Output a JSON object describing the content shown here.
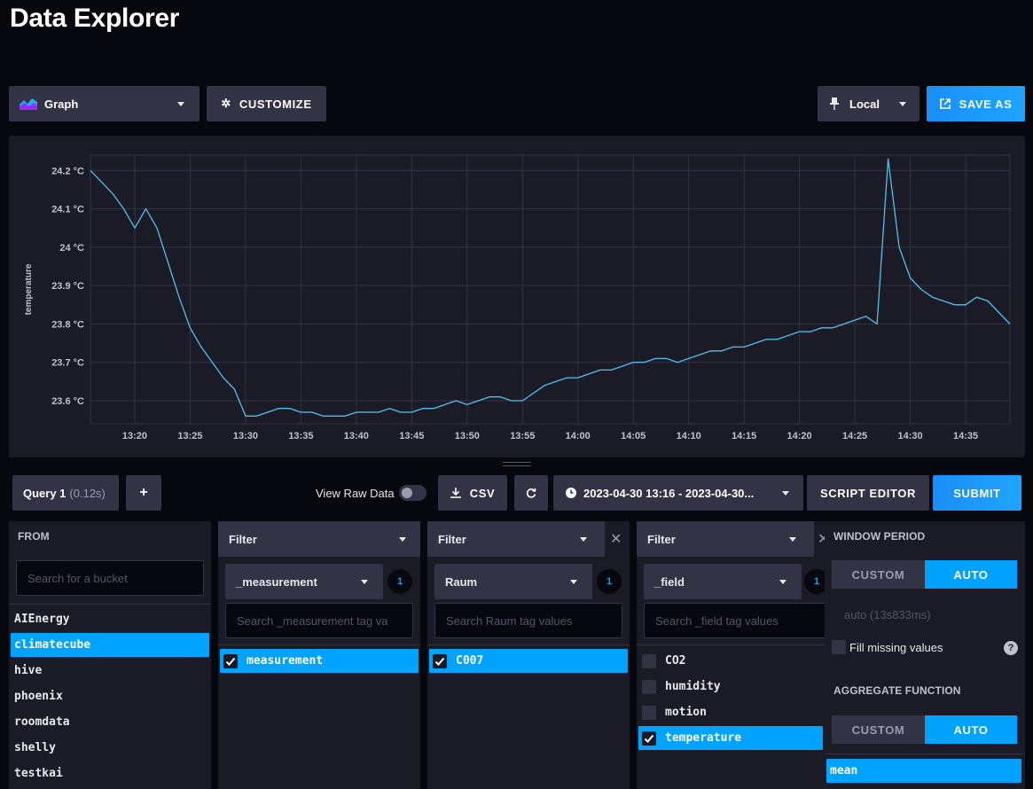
{
  "page": {
    "title": "Data Explorer"
  },
  "toolbar": {
    "graph_type": "Graph",
    "customize": "CUSTOMIZE",
    "timezone": "Local",
    "save_as": "SAVE AS"
  },
  "chart_data": {
    "type": "line",
    "title": "",
    "xlabel": "",
    "ylabel": "temperature",
    "unit": "°C",
    "xlim": [
      "13:16",
      "14:39"
    ],
    "ylim": [
      23.54,
      24.24
    ],
    "yticks": [
      "24.2 °C",
      "24.1 °C",
      "24 °C",
      "23.9 °C",
      "23.8 °C",
      "23.7 °C",
      "23.6 °C"
    ],
    "xticks": [
      "13:20",
      "13:25",
      "13:30",
      "13:35",
      "13:40",
      "13:45",
      "13:50",
      "13:55",
      "14:00",
      "14:05",
      "14:10",
      "14:15",
      "14:20",
      "14:25",
      "14:30",
      "14:35"
    ],
    "grid": true,
    "line_color": "#4fc1f0",
    "series": [
      {
        "x": [
          "13:16",
          "13:17",
          "13:18",
          "13:19",
          "13:20",
          "13:21",
          "13:22",
          "13:23",
          "13:24",
          "13:25",
          "13:26",
          "13:27",
          "13:28",
          "13:29",
          "13:30",
          "13:31",
          "13:32",
          "13:33",
          "13:34",
          "13:35",
          "13:36",
          "13:37",
          "13:38",
          "13:39",
          "13:40",
          "13:41",
          "13:42",
          "13:43",
          "13:44",
          "13:45",
          "13:46",
          "13:47",
          "13:48",
          "13:49",
          "13:50",
          "13:51",
          "13:52",
          "13:53",
          "13:54",
          "13:55",
          "13:56",
          "13:57",
          "13:58",
          "13:59",
          "14:00",
          "14:01",
          "14:02",
          "14:03",
          "14:04",
          "14:05",
          "14:06",
          "14:07",
          "14:08",
          "14:09",
          "14:10",
          "14:11",
          "14:12",
          "14:13",
          "14:14",
          "14:15",
          "14:16",
          "14:17",
          "14:18",
          "14:19",
          "14:20",
          "14:21",
          "14:22",
          "14:23",
          "14:24",
          "14:25",
          "14:26",
          "14:27",
          "14:28",
          "14:29",
          "14:30",
          "14:31",
          "14:32",
          "14:33",
          "14:34",
          "14:35",
          "14:36",
          "14:37",
          "14:38",
          "14:39"
        ],
        "y": [
          24.2,
          24.17,
          24.14,
          24.1,
          24.05,
          24.1,
          24.05,
          23.96,
          23.87,
          23.79,
          23.74,
          23.7,
          23.66,
          23.63,
          23.56,
          23.56,
          23.57,
          23.58,
          23.58,
          23.57,
          23.57,
          23.56,
          23.56,
          23.56,
          23.57,
          23.57,
          23.57,
          23.58,
          23.57,
          23.57,
          23.58,
          23.58,
          23.59,
          23.6,
          23.59,
          23.6,
          23.61,
          23.61,
          23.6,
          23.6,
          23.62,
          23.64,
          23.65,
          23.66,
          23.66,
          23.67,
          23.68,
          23.68,
          23.69,
          23.7,
          23.7,
          23.71,
          23.71,
          23.7,
          23.71,
          23.72,
          23.73,
          23.73,
          23.74,
          23.74,
          23.75,
          23.76,
          23.76,
          23.77,
          23.78,
          23.78,
          23.79,
          23.79,
          23.8,
          23.81,
          23.82,
          23.8,
          24.23,
          24.0,
          23.92,
          23.89,
          23.87,
          23.86,
          23.85,
          23.85,
          23.87,
          23.86,
          23.83,
          23.8
        ]
      }
    ]
  },
  "query_bar": {
    "tab_name": "Query 1",
    "tab_time": "(0.12s)",
    "add": "+",
    "view_raw": "View Raw Data",
    "csv": "CSV",
    "time_range": "2023-04-30 13:16 - 2023-04-30...",
    "script_editor": "SCRIPT EDITOR",
    "submit": "SUBMIT"
  },
  "from": {
    "header": "FROM",
    "search_placeholder": "Search for a bucket",
    "buckets": [
      "AIEnergy",
      "climatecube",
      "hive",
      "phoenix",
      "roomdata",
      "shelly",
      "testkai"
    ],
    "selected": "climatecube"
  },
  "filters": [
    {
      "header": "Filter",
      "key": "_measurement",
      "count": "1",
      "search_placeholder": "Search _measurement tag va",
      "values": [
        {
          "label": "measurement",
          "checked": true
        }
      ]
    },
    {
      "header": "Filter",
      "key": "Raum",
      "count": "1",
      "search_placeholder": "Search Raum tag values",
      "values": [
        {
          "label": "C007",
          "checked": true
        }
      ]
    },
    {
      "header": "Filter",
      "key": "_field",
      "count": "1",
      "search_placeholder": "Search _field tag values",
      "values": [
        {
          "label": "CO2",
          "checked": false
        },
        {
          "label": "humidity",
          "checked": false
        },
        {
          "label": "motion",
          "checked": false
        },
        {
          "label": "temperature",
          "checked": true
        }
      ]
    }
  ],
  "window": {
    "header": "WINDOW PERIOD",
    "custom": "CUSTOM",
    "auto": "AUTO",
    "auto_value": "auto (13s833ms)",
    "fill_missing": "Fill missing values",
    "aggregate_header": "AGGREGATE FUNCTION",
    "agg_custom": "CUSTOM",
    "agg_auto": "AUTO",
    "agg_selected": "mean"
  }
}
